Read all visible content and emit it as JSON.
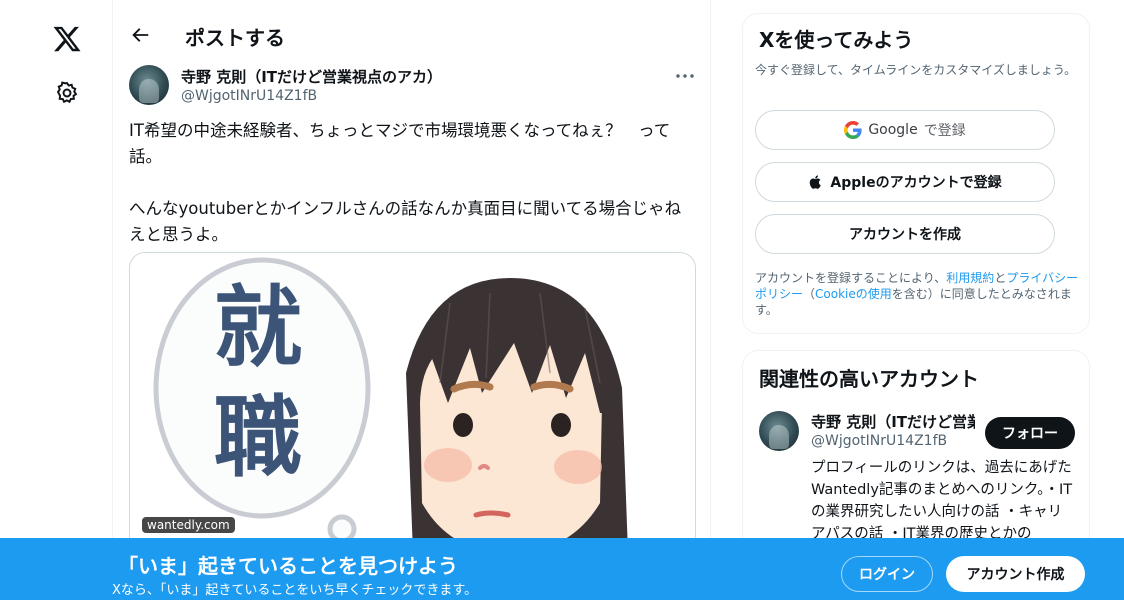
{
  "nav": {
    "logo_icon": "x-logo-icon",
    "settings_icon": "gear-icon"
  },
  "header": {
    "back_icon": "arrow-left-icon",
    "title": "ポストする"
  },
  "post": {
    "author_name": "寺野 克則（ITだけど営業視点のアカ）",
    "author_handle": "@WjgotINrU14Z1fB",
    "more_icon": "more-dots-icon",
    "text_1": "IT希望の中途未経験者、ちょっとマジで市場環境悪くなってねぇ？　って話。",
    "text_2": "へんなyoutuberとかインフルさんの話なんか真面目に聞いてる場合じゃねえと思うよ。",
    "media": {
      "source": "wantedly.com",
      "bubble_chars": [
        "就",
        "職"
      ]
    }
  },
  "signup_card": {
    "title": "Xを使ってみよう",
    "subtitle": "今すぐ登録して、タイムラインをカスタマイズしましょう。",
    "google_label": "Google",
    "google_suffix": "で登録",
    "apple_label": "Appleのアカウントで登録",
    "create_label": "アカウントを作成",
    "legal_1": "アカウントを登録することにより、",
    "legal_terms": "利用規約",
    "legal_and": "と",
    "legal_privacy": "プライバシーポリシー",
    "legal_paren_open": "（",
    "legal_cookie": "Cookieの使用",
    "legal_2": "を含む）に同意したとみなされます。"
  },
  "related": {
    "title": "関連性の高いアカウント",
    "name": "寺野 克則（ITだけど営業視点のアカ）",
    "handle": "@WjgotINrU14Z1fB",
    "follow_label": "フォロー",
    "bio": "プロフィールのリンクは、過去にあげたWantedly記事のまとめへのリンク。・ITの業界研究したい人向けの話 ・キャリアパスの話 ・IT業界の歴史とかの"
  },
  "banner": {
    "title": "「いま」起きていることを見つけよう",
    "subtitle": "Xなら、「いま」起きていることをいち早くチェックできます。",
    "login_label": "ログイン",
    "signup_label": "アカウント作成"
  },
  "colors": {
    "accent": "#1d9bf0",
    "text": "#0f1419",
    "muted": "#536471"
  }
}
